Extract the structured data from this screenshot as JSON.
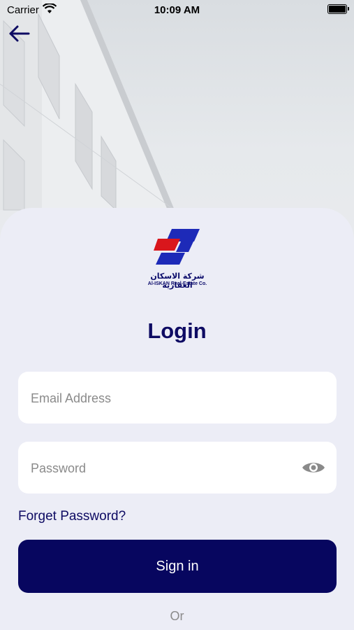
{
  "status_bar": {
    "carrier": "Carrier",
    "time": "10:09 AM"
  },
  "logo": {
    "arabic_text": "شركة الاسكان العقارية",
    "english_text": "Al-ISKAN Real-Estate Co."
  },
  "title": "Login",
  "email": {
    "placeholder": "Email Address",
    "value": ""
  },
  "password": {
    "placeholder": "Password",
    "value": ""
  },
  "forgot_label": "Forget Password?",
  "signin_label": "Sign in",
  "or_label": "Or",
  "colors": {
    "primary": "#07065f",
    "card_bg": "#ecedf6",
    "logo_red": "#d9161c",
    "logo_blue": "#1d2ab8"
  }
}
